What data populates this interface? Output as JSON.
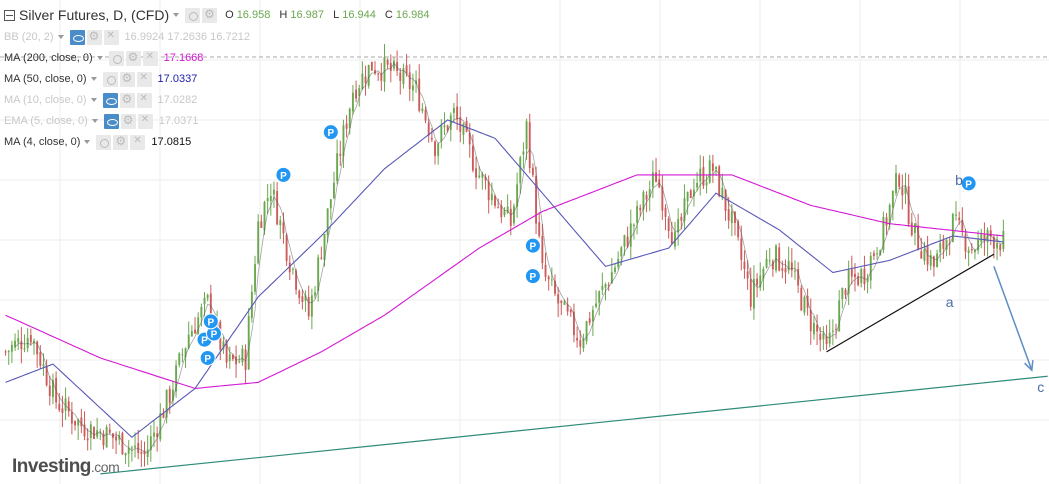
{
  "header": {
    "title": "Silver Futures, D, (CFD)",
    "ohlc": [
      {
        "key": "O",
        "value": "16.958"
      },
      {
        "key": "H",
        "value": "16.987"
      },
      {
        "key": "L",
        "value": "16.944"
      },
      {
        "key": "C",
        "value": "16.984"
      }
    ]
  },
  "indicators": [
    {
      "label": "BB (20, 2)",
      "value": "16.9924 17.2636 16.7212",
      "faded": true,
      "eye": true,
      "color": "#c8c8c8"
    },
    {
      "label": "MA (200, close, 0)",
      "value": "17.1668",
      "faded": false,
      "eye": false,
      "color": "#d418d4"
    },
    {
      "label": "MA (50, close, 0)",
      "value": "17.0337",
      "faded": false,
      "eye": false,
      "color": "#2222aa"
    },
    {
      "label": "MA (10, close, 0)",
      "value": "17.0282",
      "faded": true,
      "eye": true,
      "color": "#c8c8c8"
    },
    {
      "label": "EMA (5, close, 0)",
      "value": "17.0371",
      "faded": true,
      "eye": true,
      "color": "#c8c8c8"
    },
    {
      "label": "MA (4, close, 0)",
      "value": "17.0815",
      "faded": false,
      "eye": false,
      "color": "#111111"
    }
  ],
  "logo": {
    "main": "Investing",
    "suffix": ".com"
  },
  "annotations": {
    "wave_a": "a",
    "wave_b": "b",
    "wave_c": "c",
    "marker_glyph": "P"
  },
  "colors": {
    "up_candle": "#6aa84f",
    "down_candle": "#cc5b5b",
    "ma200": "#d418d4",
    "ma50": "#5858b8",
    "ma4": "#555555",
    "trendline_long": "#2e8b7a",
    "trendline_short": "#111111",
    "projection_arrow": "#5b8ec4",
    "marker": "#2196f3",
    "grid": "#ececec"
  },
  "chart_data": {
    "type": "candlestick",
    "title": "Silver Futures, D, (CFD)",
    "ylim": [
      15.0,
      18.9
    ],
    "num_bars": 330,
    "grid": true,
    "close_keypoints": [
      [
        0,
        16.05
      ],
      [
        8,
        16.2
      ],
      [
        16,
        15.65
      ],
      [
        24,
        15.45
      ],
      [
        34,
        15.35
      ],
      [
        44,
        15.2
      ],
      [
        52,
        15.7
      ],
      [
        58,
        16.2
      ],
      [
        64,
        16.45
      ],
      [
        70,
        15.95
      ],
      [
        76,
        16.0
      ],
      [
        80,
        17.1
      ],
      [
        84,
        17.4
      ],
      [
        90,
        16.8
      ],
      [
        96,
        16.35
      ],
      [
        104,
        17.45
      ],
      [
        110,
        18.2
      ],
      [
        116,
        18.4
      ],
      [
        122,
        18.35
      ],
      [
        130,
        18.2
      ],
      [
        136,
        17.75
      ],
      [
        142,
        18.0
      ],
      [
        150,
        17.5
      ],
      [
        156,
        17.25
      ],
      [
        160,
        17.1
      ],
      [
        165,
        17.9
      ],
      [
        170,
        16.7
      ],
      [
        176,
        16.4
      ],
      [
        182,
        16.15
      ],
      [
        186,
        16.4
      ],
      [
        192,
        16.7
      ],
      [
        198,
        17.05
      ],
      [
        206,
        17.5
      ],
      [
        212,
        16.95
      ],
      [
        218,
        17.45
      ],
      [
        224,
        17.55
      ],
      [
        230,
        17.1
      ],
      [
        236,
        16.5
      ],
      [
        242,
        16.85
      ],
      [
        248,
        16.75
      ],
      [
        254,
        16.35
      ],
      [
        260,
        16.05
      ],
      [
        266,
        16.6
      ],
      [
        272,
        16.7
      ],
      [
        278,
        17.05
      ],
      [
        283,
        17.5
      ],
      [
        288,
        17.0
      ],
      [
        294,
        16.75
      ],
      [
        300,
        17.1
      ],
      [
        306,
        16.9
      ],
      [
        312,
        17.0
      ],
      [
        316,
        16.95
      ]
    ],
    "ma200_keypoints": [
      [
        0,
        16.35
      ],
      [
        30,
        16.0
      ],
      [
        60,
        15.75
      ],
      [
        80,
        15.8
      ],
      [
        100,
        16.05
      ],
      [
        120,
        16.35
      ],
      [
        150,
        16.9
      ],
      [
        170,
        17.2
      ],
      [
        200,
        17.5
      ],
      [
        230,
        17.5
      ],
      [
        255,
        17.25
      ],
      [
        280,
        17.1
      ],
      [
        316,
        17.0
      ]
    ],
    "ma50_keypoints": [
      [
        0,
        15.8
      ],
      [
        15,
        15.95
      ],
      [
        40,
        15.35
      ],
      [
        60,
        15.75
      ],
      [
        80,
        16.5
      ],
      [
        100,
        17.0
      ],
      [
        120,
        17.55
      ],
      [
        140,
        17.95
      ],
      [
        155,
        17.8
      ],
      [
        170,
        17.35
      ],
      [
        190,
        16.75
      ],
      [
        210,
        16.9
      ],
      [
        225,
        17.35
      ],
      [
        245,
        17.05
      ],
      [
        262,
        16.7
      ],
      [
        280,
        16.8
      ],
      [
        300,
        17.0
      ],
      [
        316,
        16.95
      ]
    ],
    "markers": [
      {
        "bar": 63,
        "price": 16.15
      },
      {
        "bar": 64,
        "price": 16.0
      },
      {
        "bar": 66,
        "price": 16.2
      },
      {
        "bar": 65,
        "price": 16.3
      },
      {
        "bar": 88,
        "price": 17.5
      },
      {
        "bar": 103,
        "price": 17.85
      },
      {
        "bar": 167,
        "price": 16.92
      },
      {
        "bar": 167,
        "price": 16.67
      },
      {
        "bar": 305,
        "price": 17.43
      }
    ],
    "trendlines": [
      {
        "role": "long",
        "from": [
          30,
          15.05
        ],
        "to": [
          330,
          15.85
        ]
      },
      {
        "role": "short",
        "from": [
          260,
          16.05
        ],
        "to": [
          313,
          16.85
        ]
      },
      {
        "role": "projection",
        "from": [
          313,
          16.75
        ],
        "to": [
          325,
          15.9
        ]
      }
    ]
  }
}
